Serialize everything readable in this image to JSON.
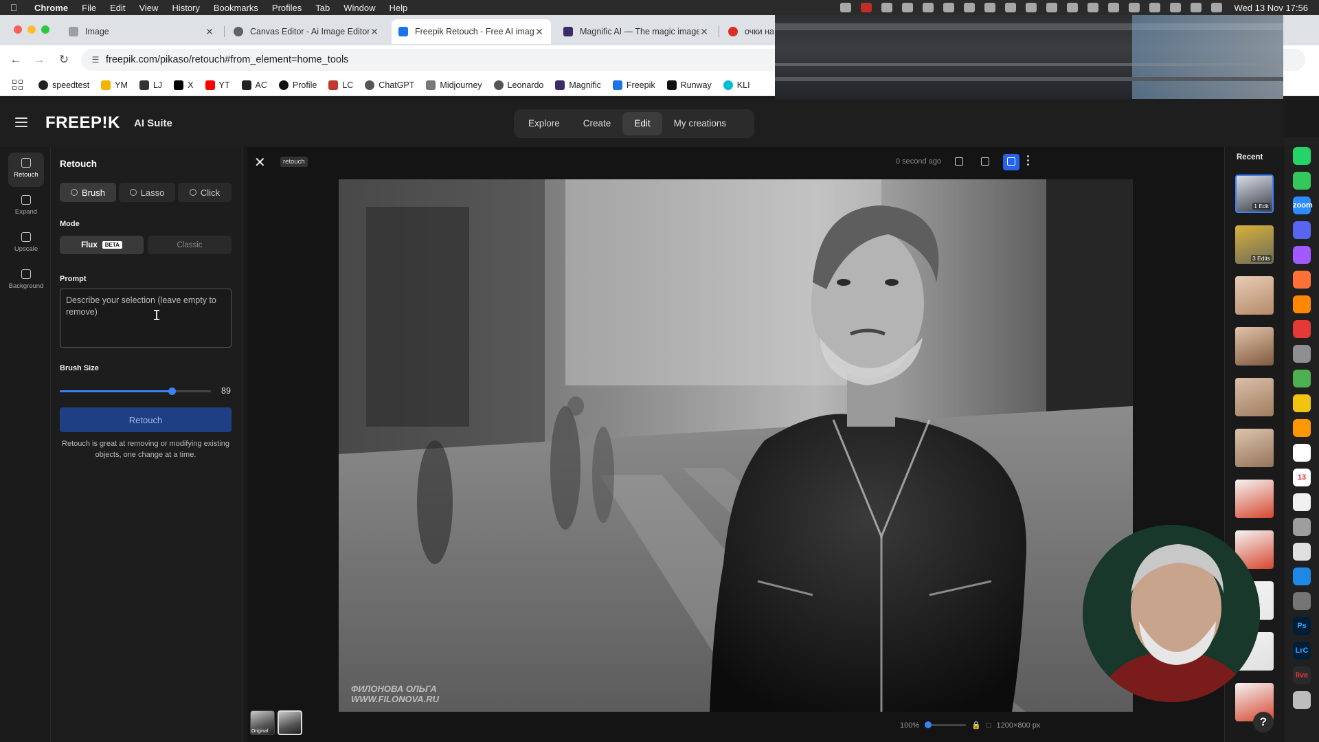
{
  "menubar": {
    "app": "Chrome",
    "items": [
      "File",
      "Edit",
      "View",
      "History",
      "Bookmarks",
      "Profiles",
      "Tab",
      "Window",
      "Help"
    ],
    "clock": "Wed 13 Nov 17:56"
  },
  "tabs": [
    {
      "title": "Image",
      "favicon_color": "#9aa0a6"
    },
    {
      "title": "Canvas Editor - Ai Image Editor",
      "favicon_color": "#5f6368"
    },
    {
      "title": "Freepik Retouch - Free AI image",
      "favicon_color": "#1a73e8"
    },
    {
      "title": "Magnific AI — The magic image",
      "favicon_color": "#3c2a6b"
    },
    {
      "title": "очки на л",
      "favicon_color": "#d93025"
    }
  ],
  "address": {
    "url": "freepik.com/pikaso/retouch#from_element=home_tools"
  },
  "bookmarks": [
    {
      "label": "speedtest",
      "color": "#222"
    },
    {
      "label": "YM",
      "color": "#f4b400"
    },
    {
      "label": "LJ",
      "color": "#333"
    },
    {
      "label": "X",
      "color": "#000"
    },
    {
      "label": "YT",
      "color": "#ff0000"
    },
    {
      "label": "AC",
      "color": "#222"
    },
    {
      "label": "Profile",
      "color": "#111"
    },
    {
      "label": "LC",
      "color": "#c0392b"
    },
    {
      "label": "ChatGPT",
      "color": "#555"
    },
    {
      "label": "Midjourney",
      "color": "#777"
    },
    {
      "label": "Leonardo",
      "color": "#555"
    },
    {
      "label": "Magnific",
      "color": "#3c2a6b"
    },
    {
      "label": "Freepik",
      "color": "#1a73e8"
    },
    {
      "label": "Runway",
      "color": "#111"
    },
    {
      "label": "KLI",
      "color": "#00bcd4"
    }
  ],
  "header": {
    "logo": "FREEP!K",
    "suite": "AI Suite",
    "nav": [
      "Explore",
      "Create",
      "Edit",
      "My creations"
    ],
    "nav_selected": "Edit"
  },
  "rail": [
    {
      "label": "Retouch",
      "selected": true
    },
    {
      "label": "Expand",
      "selected": false
    },
    {
      "label": "Upscale",
      "selected": false
    },
    {
      "label": "Background",
      "selected": false
    }
  ],
  "panel": {
    "title": "Retouch",
    "tools": [
      "Brush",
      "Lasso",
      "Click"
    ],
    "mode_label": "Mode",
    "mode_flux": "Flux",
    "mode_beta": "BETA",
    "mode_classic": "Classic",
    "prompt_label": "Prompt",
    "prompt_placeholder": "Describe your selection (leave empty to remove)",
    "brush_label": "Brush Size",
    "brush_value": "89",
    "brush_fraction": 0.74,
    "retouch_button": "Retouch",
    "hint": "Retouch is great at removing or modifying existing objects, one change at a time."
  },
  "canvas": {
    "tag": "retouch",
    "timestamp": "0 second ago",
    "watermark_line1": "ФИЛОНОВА ОЛЬГА",
    "watermark_line2": "WWW.FILONOVA.RU",
    "thumb_original": "Original",
    "zoom": "100%",
    "zoom_fraction": 0.0,
    "dimensions": "1200×800 px"
  },
  "recent": {
    "title": "Recent",
    "items": [
      {
        "badge": "1 Edit",
        "colors": [
          "#d8dde6",
          "#3a3f4a"
        ]
      },
      {
        "badge": "3 Edits",
        "colors": [
          "#d9b23a",
          "#6b6b5a"
        ]
      },
      {
        "badge": "",
        "colors": [
          "#e8cdb5",
          "#b58a6a"
        ]
      },
      {
        "badge": "",
        "colors": [
          "#e2c4aa",
          "#7f5a3f"
        ]
      },
      {
        "badge": "",
        "colors": [
          "#d9c0a8",
          "#a07d60"
        ]
      },
      {
        "badge": "",
        "colors": [
          "#dcc5ad",
          "#94745a"
        ]
      },
      {
        "badge": "",
        "colors": [
          "#f5f5f5",
          "#d6472f"
        ]
      },
      {
        "badge": "",
        "colors": [
          "#f5f5f5",
          "#d6472f"
        ]
      },
      {
        "badge": "",
        "colors": [
          "#f2f2f2",
          "#e9e9e9"
        ]
      },
      {
        "badge": "",
        "colors": [
          "#f2f2f2",
          "#e0e0e0"
        ]
      },
      {
        "badge": "",
        "colors": [
          "#f5f5f5",
          "#d6472f"
        ]
      }
    ]
  },
  "help": "?",
  "dock": [
    {
      "name": "whatsapp-icon",
      "color": "#25d366",
      "label": ""
    },
    {
      "name": "messages-icon",
      "color": "#34c759",
      "label": ""
    },
    {
      "name": "zoom-icon",
      "color": "#2d8cff",
      "label": "zoom"
    },
    {
      "name": "discord-icon",
      "color": "#5865f2",
      "label": ""
    },
    {
      "name": "figma-icon",
      "color": "#a259ff",
      "label": ""
    },
    {
      "name": "firefox-icon",
      "color": "#ff7139",
      "label": ""
    },
    {
      "name": "vlc-icon",
      "color": "#ff8800",
      "label": ""
    },
    {
      "name": "books-icon",
      "color": "#e53935",
      "label": ""
    },
    {
      "name": "settings-icon",
      "color": "#8e8e93",
      "label": ""
    },
    {
      "name": "stack-icon",
      "color": "#4caf50",
      "label": ""
    },
    {
      "name": "finder-icon",
      "color": "#f1c40f",
      "label": ""
    },
    {
      "name": "podcast-icon",
      "color": "#ff9800",
      "label": ""
    },
    {
      "name": "chatgpt-icon",
      "color": "#ffffff",
      "label": ""
    },
    {
      "name": "calendar-icon",
      "color": "#ffffff",
      "label": "13"
    },
    {
      "name": "notes-icon",
      "color": "#f0f0f0",
      "label": ""
    },
    {
      "name": "calculator-icon",
      "color": "#9e9e9e",
      "label": ""
    },
    {
      "name": "preview-icon",
      "color": "#e0e0e0",
      "label": ""
    },
    {
      "name": "appstore-icon",
      "color": "#1e88e5",
      "label": ""
    },
    {
      "name": "camera-icon",
      "color": "#757575",
      "label": ""
    },
    {
      "name": "photoshop-icon",
      "color": "#001e36",
      "label": "Ps"
    },
    {
      "name": "lightroom-icon",
      "color": "#001e36",
      "label": "LrC"
    },
    {
      "name": "live-icon",
      "color": "#2a2a2a",
      "label": "live"
    },
    {
      "name": "trash-icon",
      "color": "#bdbdbd",
      "label": ""
    }
  ]
}
